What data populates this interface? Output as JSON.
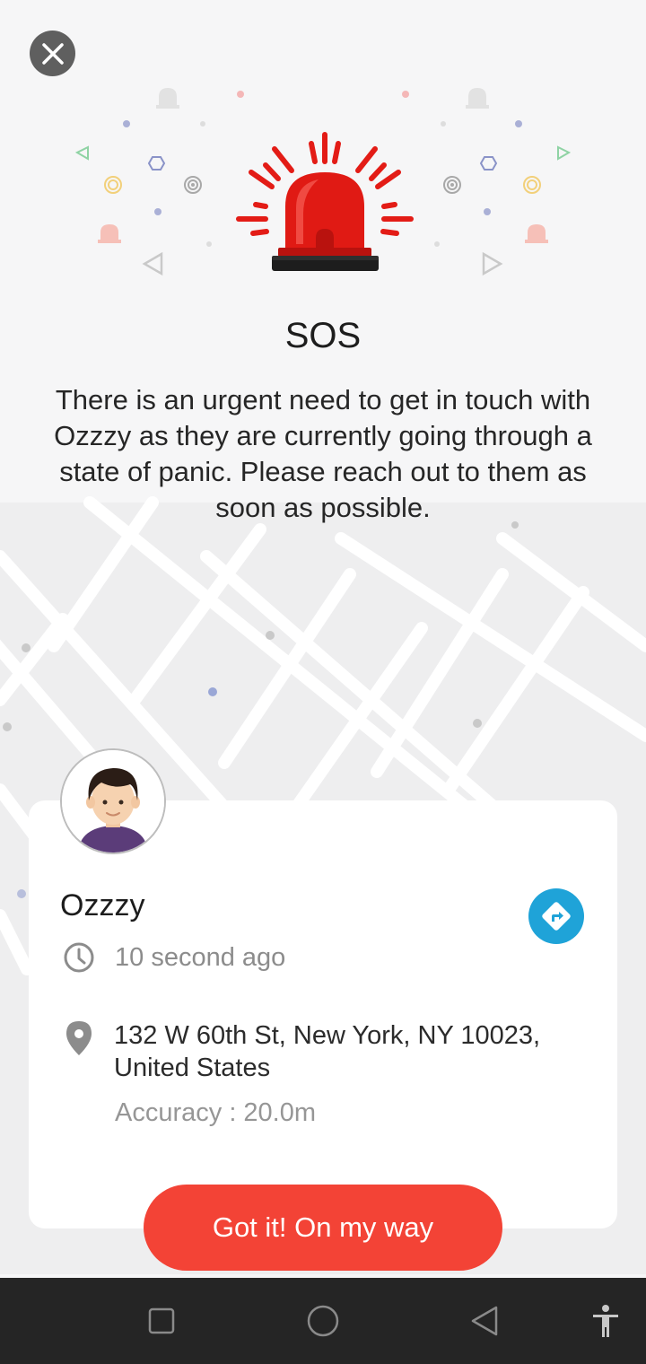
{
  "sos": {
    "title": "SOS",
    "message": "There is an urgent need to get in touch with Ozzzy as they are currently going through a state of panic. Please reach out to them as soon as possible."
  },
  "contact": {
    "name": "Ozzzy",
    "time_ago": "10 second ago",
    "address": "132 W 60th St, New York, NY 10023, United States",
    "accuracy": "Accuracy : 20.0m"
  },
  "actions": {
    "confirm_label": "Got it! On my way"
  },
  "icons": {
    "close": "close-icon",
    "alarm": "siren-icon",
    "directions": "directions-icon",
    "clock": "clock-icon",
    "location": "location-pin-icon",
    "nav_recent": "square-icon",
    "nav_home": "circle-icon",
    "nav_back": "triangle-back-icon",
    "accessibility": "accessibility-icon"
  },
  "colors": {
    "siren_red": "#e31c16",
    "cta_red": "#f34336",
    "direction_blue": "#1fa3d8",
    "navbar": "#252525"
  }
}
